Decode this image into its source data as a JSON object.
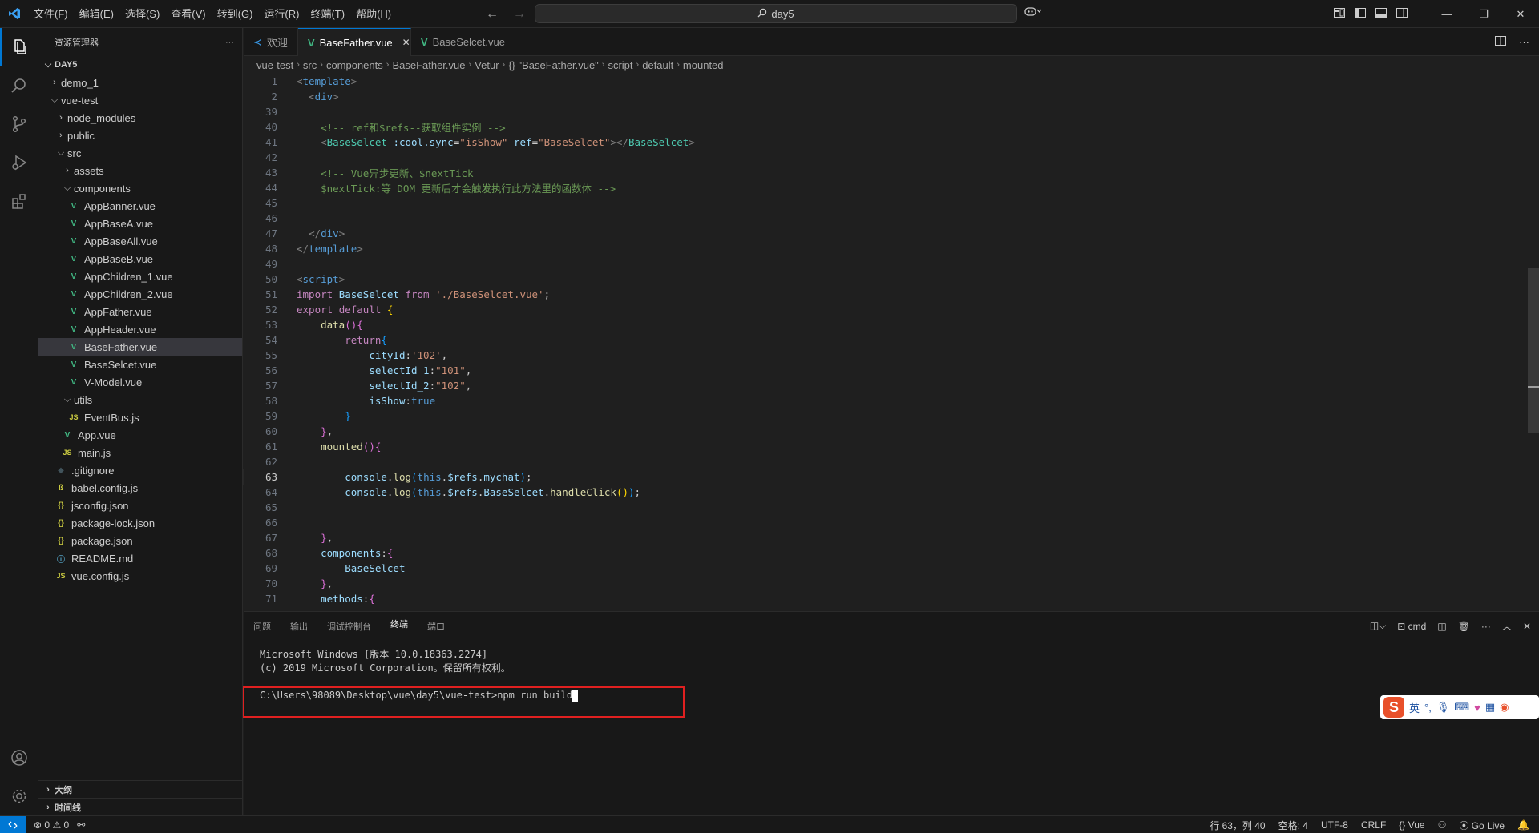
{
  "titlebar": {
    "menu": [
      "文件(F)",
      "编辑(E)",
      "选择(S)",
      "查看(V)",
      "转到(G)",
      "运行(R)",
      "终端(T)",
      "帮助(H)"
    ],
    "search": "day5"
  },
  "sidebar": {
    "title": "资源管理器",
    "more": "···",
    "root": "DAY5",
    "items": [
      {
        "label": "demo_1",
        "depth": 1,
        "kind": "folder",
        "open": false
      },
      {
        "label": "vue-test",
        "depth": 1,
        "kind": "folder",
        "open": true
      },
      {
        "label": "node_modules",
        "depth": 2,
        "kind": "folder",
        "open": false
      },
      {
        "label": "public",
        "depth": 2,
        "kind": "folder",
        "open": false
      },
      {
        "label": "src",
        "depth": 2,
        "kind": "folder",
        "open": true
      },
      {
        "label": "assets",
        "depth": 3,
        "kind": "folder",
        "open": false
      },
      {
        "label": "components",
        "depth": 3,
        "kind": "folder",
        "open": true
      },
      {
        "label": "AppBanner.vue",
        "depth": 4,
        "kind": "vue"
      },
      {
        "label": "AppBaseA.vue",
        "depth": 4,
        "kind": "vue"
      },
      {
        "label": "AppBaseAll.vue",
        "depth": 4,
        "kind": "vue"
      },
      {
        "label": "AppBaseB.vue",
        "depth": 4,
        "kind": "vue"
      },
      {
        "label": "AppChildren_1.vue",
        "depth": 4,
        "kind": "vue"
      },
      {
        "label": "AppChildren_2.vue",
        "depth": 4,
        "kind": "vue"
      },
      {
        "label": "AppFather.vue",
        "depth": 4,
        "kind": "vue"
      },
      {
        "label": "AppHeader.vue",
        "depth": 4,
        "kind": "vue"
      },
      {
        "label": "BaseFather.vue",
        "depth": 4,
        "kind": "vue",
        "selected": true
      },
      {
        "label": "BaseSelcet.vue",
        "depth": 4,
        "kind": "vue"
      },
      {
        "label": "V-Model.vue",
        "depth": 4,
        "kind": "vue"
      },
      {
        "label": "utils",
        "depth": 3,
        "kind": "folder",
        "open": true
      },
      {
        "label": "EventBus.js",
        "depth": 4,
        "kind": "js"
      },
      {
        "label": "App.vue",
        "depth": 3,
        "kind": "vue"
      },
      {
        "label": "main.js",
        "depth": 3,
        "kind": "js"
      },
      {
        "label": ".gitignore",
        "depth": 2,
        "kind": "git"
      },
      {
        "label": "babel.config.js",
        "depth": 2,
        "kind": "babel"
      },
      {
        "label": "jsconfig.json",
        "depth": 2,
        "kind": "json"
      },
      {
        "label": "package-lock.json",
        "depth": 2,
        "kind": "json"
      },
      {
        "label": "package.json",
        "depth": 2,
        "kind": "json"
      },
      {
        "label": "README.md",
        "depth": 2,
        "kind": "info"
      },
      {
        "label": "vue.config.js",
        "depth": 2,
        "kind": "js"
      }
    ],
    "outline": "大纲",
    "timeline": "时间线"
  },
  "tabs": [
    {
      "label": "欢迎",
      "kind": "welcome",
      "active": false
    },
    {
      "label": "BaseFather.vue",
      "kind": "vue",
      "active": true
    },
    {
      "label": "BaseSelcet.vue",
      "kind": "vue",
      "active": false
    }
  ],
  "breadcrumb": [
    "vue-test",
    "src",
    "components",
    "BaseFather.vue",
    "Vetur",
    "{} \"BaseFather.vue\"",
    "script",
    "default",
    "mounted"
  ],
  "code": [
    {
      "n": "1",
      "html": "<span class='t-gray'>&lt;</span><span class='t-tag'>template</span><span class='t-gray'>&gt;</span>"
    },
    {
      "n": "2",
      "html": "  <span class='t-gray'>&lt;</span><span class='t-tag'>div</span><span class='t-gray'>&gt;</span>"
    },
    {
      "n": "39",
      "html": ""
    },
    {
      "n": "40",
      "html": "    <span class='t-comment'>&lt;!-- ref和$refs--获取组件实例 --&gt;</span>"
    },
    {
      "n": "41",
      "html": "    <span class='t-gray'>&lt;</span><span class='t-const'>BaseSelcet</span> <span class='t-attr'>:cool.sync</span>=<span class='t-str'>\"isShow\"</span> <span class='t-attr'>ref</span>=<span class='t-str'>\"BaseSelcet\"</span><span class='t-gray'>&gt;&lt;/</span><span class='t-const'>BaseSelcet</span><span class='t-gray'>&gt;</span>"
    },
    {
      "n": "42",
      "html": ""
    },
    {
      "n": "43",
      "html": "    <span class='t-comment'>&lt;!-- Vue异步更新、$nextTick</span>"
    },
    {
      "n": "44",
      "html": "    <span class='t-comment'>$nextTick:等 DOM 更新后才会触发执行此方法里的函数体 --&gt;</span>"
    },
    {
      "n": "45",
      "html": ""
    },
    {
      "n": "46",
      "html": ""
    },
    {
      "n": "47",
      "html": "  <span class='t-gray'>&lt;/</span><span class='t-tag'>div</span><span class='t-gray'>&gt;</span>"
    },
    {
      "n": "48",
      "html": "<span class='t-gray'>&lt;/</span><span class='t-tag'>template</span><span class='t-gray'>&gt;</span>"
    },
    {
      "n": "49",
      "html": ""
    },
    {
      "n": "50",
      "html": "<span class='t-gray'>&lt;</span><span class='t-tag'>script</span><span class='t-gray'>&gt;</span>"
    },
    {
      "n": "51",
      "html": "<span class='t-kw'>import</span> <span class='t-var'>BaseSelcet</span> <span class='t-kw'>from</span> <span class='t-str'>'./BaseSelcet.vue'</span>;"
    },
    {
      "n": "52",
      "html": "<span class='t-kw'>export</span> <span class='t-kw'>default</span> <span class='t-y'>{</span>"
    },
    {
      "n": "53",
      "html": "    <span class='t-fn'>data</span><span class='t-p'>()</span><span class='t-p'>{</span>"
    },
    {
      "n": "54",
      "html": "        <span class='t-kw'>return</span><span class='t-b2'>{</span>"
    },
    {
      "n": "55",
      "html": "            <span class='t-var'>cityId</span>:<span class='t-str'>'102'</span>,"
    },
    {
      "n": "56",
      "html": "            <span class='t-var'>selectId_1</span>:<span class='t-str'>\"101\"</span>,"
    },
    {
      "n": "57",
      "html": "            <span class='t-var'>selectId_2</span>:<span class='t-str'>\"102\"</span>,"
    },
    {
      "n": "58",
      "html": "            <span class='t-var'>isShow</span>:<span class='t-blue'>true</span>"
    },
    {
      "n": "59",
      "html": "        <span class='t-b2'>}</span>"
    },
    {
      "n": "60",
      "html": "    <span class='t-p'>}</span>,"
    },
    {
      "n": "61",
      "html": "    <span class='t-fn'>mounted</span><span class='t-p'>()</span><span class='t-p'>{</span>"
    },
    {
      "n": "62",
      "html": "        "
    },
    {
      "n": "63",
      "html": "        <span class='t-var'>console</span>.<span class='t-fn'>log</span><span class='t-b2'>(</span><span class='t-blue'>this</span>.<span class='t-var'>$refs</span>.<span class='t-var'>mychat</span><span class='t-b2'>)</span>;",
      "current": true
    },
    {
      "n": "64",
      "html": "        <span class='t-var'>console</span>.<span class='t-fn'>log</span><span class='t-b2'>(</span><span class='t-blue'>this</span>.<span class='t-var'>$refs</span>.<span class='t-var'>BaseSelcet</span>.<span class='t-fn'>handleClick</span><span class='t-y'>()</span><span class='t-b2'>)</span>;"
    },
    {
      "n": "65",
      "html": "        "
    },
    {
      "n": "66",
      "html": ""
    },
    {
      "n": "67",
      "html": "    <span class='t-p'>}</span>,"
    },
    {
      "n": "68",
      "html": "    <span class='t-var'>components</span>:<span class='t-p'>{</span>"
    },
    {
      "n": "69",
      "html": "        <span class='t-var'>BaseSelcet</span>"
    },
    {
      "n": "70",
      "html": "    <span class='t-p'>}</span>,"
    },
    {
      "n": "71",
      "html": "    <span class='t-var'>methods</span>:<span class='t-p'>{</span>"
    }
  ],
  "panel": {
    "tabs": [
      "问题",
      "输出",
      "调试控制台",
      "终端",
      "端口"
    ],
    "active_tab": "终端",
    "shell": "cmd",
    "terminal_lines": [
      "Microsoft Windows [版本 10.0.18363.2274]",
      "(c) 2019 Microsoft Corporation。保留所有权利。"
    ],
    "prompt": "C:\\Users\\98089\\Desktop\\vue\\day5\\vue-test>npm run build"
  },
  "ime": {
    "label": "英"
  },
  "status": {
    "errors": "0",
    "warnings": "0",
    "position": "行 63，列 40",
    "spaces": "空格: 4",
    "encoding": "UTF-8",
    "eol": "CRLF",
    "language": "Vue",
    "golive": "Go Live"
  },
  "colors": {
    "accent": "#0078d4",
    "vue": "#41b883",
    "highlight_box": "#e02020"
  }
}
